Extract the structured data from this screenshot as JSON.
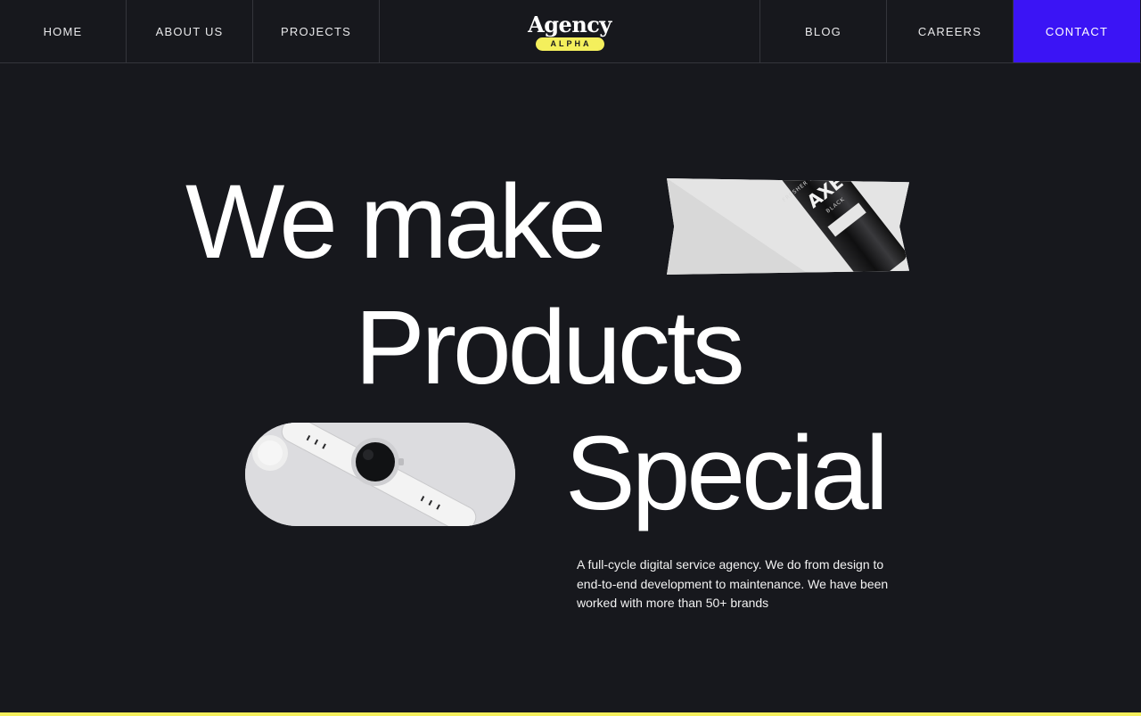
{
  "nav": {
    "left": [
      {
        "label": "HOME"
      },
      {
        "label": "ABOUT US"
      },
      {
        "label": "PROJECTS"
      }
    ],
    "right": [
      {
        "label": "BLOG"
      },
      {
        "label": "CAREERS"
      },
      {
        "label": "CONTACT"
      }
    ]
  },
  "logo": {
    "word": "Agency",
    "tag": "ALPHA"
  },
  "hero": {
    "line1": "We make",
    "line2": "Products",
    "line3": "Special",
    "description": "A full-cycle digital service agency. We do from design to end-to-end development to maintenance. We have been worked with more than 50+ brands",
    "images": {
      "top": "axe-deodorant-product-photo",
      "bottom": "smartwatch-product-photo"
    }
  },
  "colors": {
    "background": "#17181d",
    "accent_blue": "#3b14f5",
    "accent_yellow": "#f4ef5c"
  }
}
